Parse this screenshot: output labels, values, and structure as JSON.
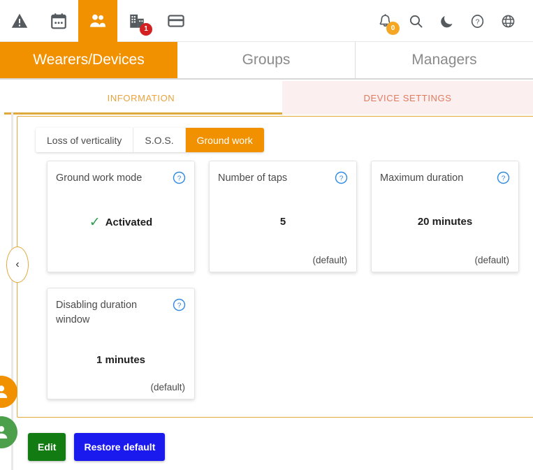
{
  "topbar": {
    "left_icons": [
      {
        "name": "alert-triangle-icon",
        "label": "Alerts",
        "active": false,
        "badge": null
      },
      {
        "name": "calendar-icon",
        "label": "Calendar",
        "active": false,
        "badge": null
      },
      {
        "name": "people-icon",
        "label": "Wearers and devices",
        "active": true,
        "badge": null
      },
      {
        "name": "building-icon",
        "label": "Sites",
        "active": false,
        "badge": "1"
      },
      {
        "name": "card-icon",
        "label": "Subscriptions",
        "active": false,
        "badge": null
      }
    ],
    "right_icons": [
      {
        "name": "bell-icon",
        "label": "Notifications",
        "badge": "0"
      },
      {
        "name": "search-icon",
        "label": "Search",
        "badge": null
      },
      {
        "name": "moon-icon",
        "label": "Dark mode",
        "badge": null
      },
      {
        "name": "help-circle-icon",
        "label": "Help",
        "badge": null
      },
      {
        "name": "globe-icon",
        "label": "Language",
        "badge": null
      }
    ],
    "badge_site": "1",
    "badge_notifications": "0"
  },
  "main_tabs": [
    {
      "label": "Wearers/Devices",
      "active": true
    },
    {
      "label": "Groups",
      "active": false
    },
    {
      "label": "Managers",
      "active": false
    }
  ],
  "sub_tabs": [
    {
      "label": "INFORMATION",
      "selected": true
    },
    {
      "label": "DEVICE SETTINGS",
      "selected": false
    }
  ],
  "chips": [
    {
      "label": "Loss of verticality",
      "active": false
    },
    {
      "label": "S.O.S.",
      "active": false
    },
    {
      "label": "Ground work",
      "active": true
    }
  ],
  "cards": [
    {
      "title": "Ground work mode",
      "value": "Activated",
      "check": "✓",
      "has_check": true,
      "default_label": "",
      "help": "?"
    },
    {
      "title": "Number of taps",
      "value": "5",
      "has_check": false,
      "default_label": "(default)",
      "help": "?"
    },
    {
      "title": "Maximum duration",
      "value": "20 minutes",
      "has_check": false,
      "default_label": "(default)",
      "help": "?"
    },
    {
      "title": "Disabling duration window",
      "value": "1 minutes",
      "has_check": false,
      "default_label": "(default)",
      "help": "?"
    }
  ],
  "footer": {
    "edit_label": "Edit",
    "restore_label": "Restore default"
  },
  "left_controls": {
    "collapse_glyph": "‹",
    "fab_orange_name": "wearer-orange-avatar-button",
    "fab_green_name": "wearer-green-avatar-button"
  },
  "colors": {
    "brand_orange": "#F29100",
    "panel_border": "#E2A93C",
    "tab_accent": "#E0A93B",
    "device_settings_bg": "#FCEFEF",
    "device_settings_fg": "#E07A5F",
    "edit_green": "#127C12",
    "restore_blue": "#1A1AEE",
    "badge_red": "#D32020",
    "badge_orange": "#F5A623",
    "check_green": "#2E9D4E",
    "help_blue": "#2E8AE5"
  }
}
